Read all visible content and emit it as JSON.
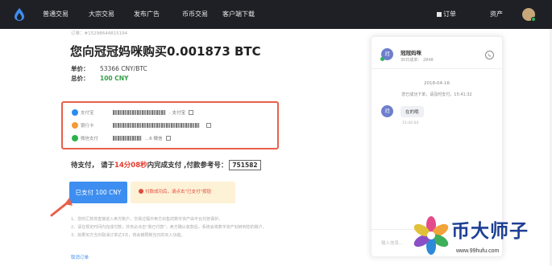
{
  "nav": {
    "items": [
      "普通交易",
      "大宗交易",
      "发布广告",
      "币币交易",
      "客户端下载"
    ],
    "orders_label": "订单",
    "assets_label": "资产"
  },
  "order": {
    "number": "订单：#15298644815194",
    "title": "您向冠冠妈咪购买0.001873 BTC",
    "unit_price_label": "单价：",
    "unit_price": "53366 CNY/BTC",
    "total_label": "总价：",
    "total": "100 CNY"
  },
  "payment_methods": [
    {
      "name": "支付宝",
      "suffix": "· 支付宝",
      "icon": "alipay-icon",
      "color": "#2a8cf0"
    },
    {
      "name": "银行卡",
      "suffix": "",
      "icon": "bank-card-icon",
      "color": "#f29a38"
    },
    {
      "name": "微信支付",
      "suffix": "...6 微信",
      "icon": "wechat-icon",
      "color": "#2bb24c"
    }
  ],
  "pending": {
    "prefix": "待支付， 请于",
    "time": "14分08秒",
    "mid": "内完成支付 ,付款参考号：",
    "ref": "751582"
  },
  "actions": {
    "paid_button": "已支付 100 CNY",
    "warning": "付款成功后，请点击\"已支付\"按钮"
  },
  "notes": [
    "1、您的汇款将直接进入卖方账户，交易过程中卖方出售的数字资产由平台托管保护。",
    "2、请在规定时间内完成付款，并务必点击\"我已付款\"，卖方确认收款后，系统会将数字资产划转到您的账户。",
    "3、如果买方当日取消订单达3次，将会被限制当日的买入功能。"
  ],
  "cancel_link": "取消订单",
  "chat": {
    "avatar_letter": "冠",
    "name": "冠冠妈咪",
    "subtitle": "30日成单：  2848",
    "date": "2018-04-16",
    "system_message": "您已成功下单，请及时支付，15:41:32",
    "message": "在的哦",
    "message_time": "15:42:04",
    "input_placeholder": "输入信息..."
  },
  "watermark": {
    "brand": "币大师子",
    "url": "www.99hufu.com"
  },
  "colors": {
    "nav_bg": "#1f2026",
    "accent_blue": "#3d8ef0",
    "alert_red": "#e23b2e",
    "highlight_border": "#e8604b",
    "price_green": "#2f9e44"
  }
}
